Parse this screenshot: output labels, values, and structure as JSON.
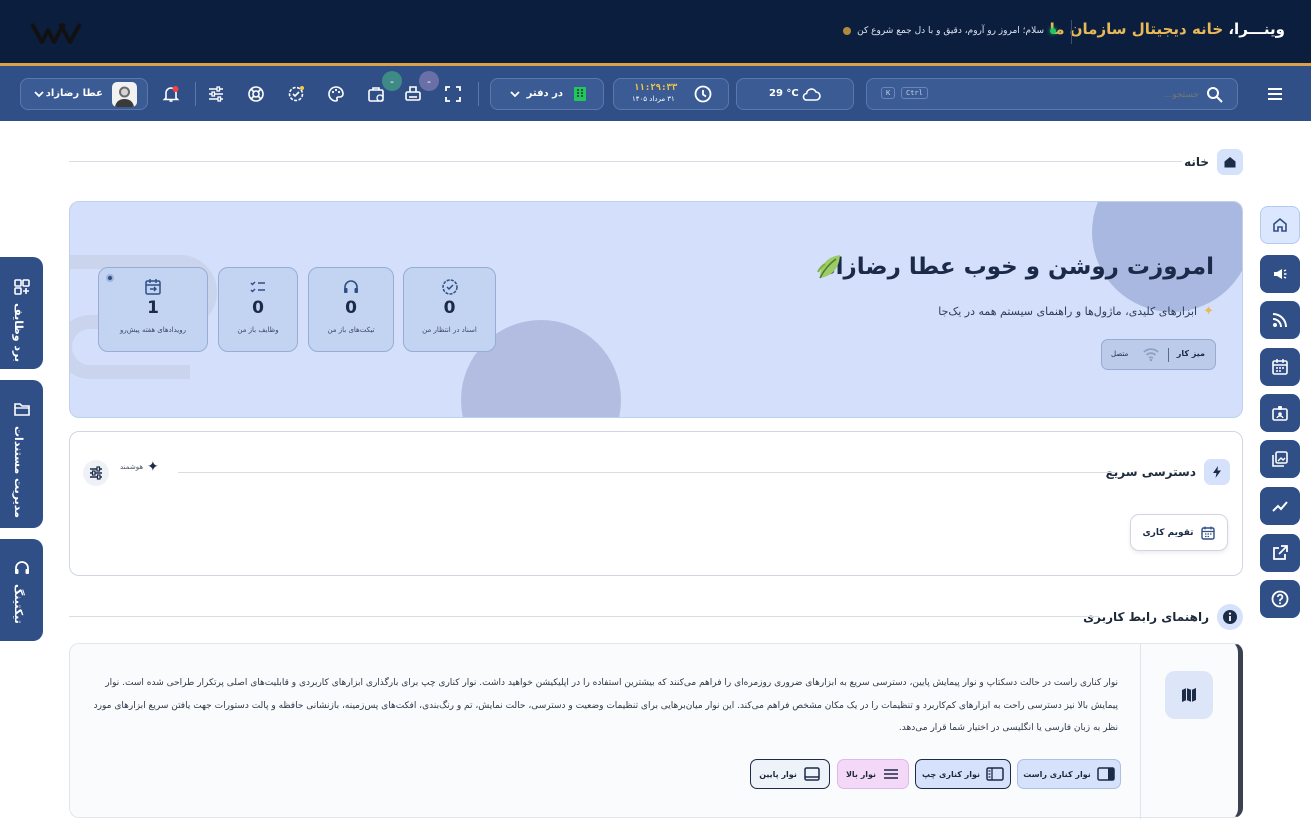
{
  "header": {
    "brand_name": "وینـــرا،",
    "brand_tag": " خانه دیجیتال سازمان ما",
    "greeting": "سلام؛ امروز رو آروم، دقیق و با دل جمع شروع کن"
  },
  "toolbar": {
    "search_placeholder": "جستجو...",
    "shortcut_ctrl": "Ctrl",
    "shortcut_k": "K",
    "weather": "29 °C",
    "time": "۱۱:۲۹:۳۳",
    "date": "۳۱ مرداد ۱۴۰۵",
    "presence": "در دفتر",
    "badge_a": "-",
    "badge_b": "-",
    "user_name": "عطا رضازاد"
  },
  "breadcrumb": {
    "label": "خانه"
  },
  "hero": {
    "title": "امروزت روشن و خوب عطا رضازاد",
    "subtitle": "ابزارهای کلیدی، ماژول‌ها و راهنمای سیستم همه در یک‌جا",
    "workspace_label": "میز کار",
    "status_label": "متصل",
    "stats": [
      {
        "value": "0",
        "label": "اسناد در انتظار من"
      },
      {
        "value": "0",
        "label": "تیکت‌های باز من"
      },
      {
        "value": "0",
        "label": "وظایف باز من"
      },
      {
        "value": "1",
        "label": "رویدادهای هفته پیش‌رو"
      }
    ]
  },
  "quick_access": {
    "title": "دسترسی سریع",
    "smart_label": "هوشمند",
    "items": [
      {
        "label": "تقویم کاری"
      }
    ]
  },
  "guide": {
    "title": "راهنمای رابط کاربری",
    "text": "نوار کناری راست در حالت دسکتاپ و نوار پیمایش پایین، دسترسی سریع به ابزارهای ضروری روزمره‌ای را فراهم می‌کنند که بیشترین استفاده را در اپلیکیشن خواهید داشت. نوار کناری چپ برای بارگذاری ابزارهای کاربردی و قابلیت‌های اصلی پرتکرار طراحی شده است. نوار پیمایش بالا نیز دسترسی راحت به ابزارهای کم‌کاربرد و تنظیمات را در یک مکان مشخص فراهم می‌کند. این نوار میان‌برهایی برای تنظیمات وضعیت و دسترسی، حالت نمایش، تم و رنگ‌بندی، افکت‌های پس‌زمینه، بازنشانی حافظه و پالت دستورات جهت یافتن سریع ابزارهای مورد نظر به زبان فارسی یا انگلیسی در اختیار شما قرار می‌دهد.",
    "chips": [
      {
        "label": "نوار کناری راست"
      },
      {
        "label": "نوار کناری چپ"
      },
      {
        "label": "نوار بالا"
      },
      {
        "label": "نوار پایین"
      }
    ]
  },
  "left_panels": [
    {
      "label": "برد وظایف"
    },
    {
      "label": "مدیریت مستندات"
    },
    {
      "label": "تیکتینگ"
    }
  ]
}
